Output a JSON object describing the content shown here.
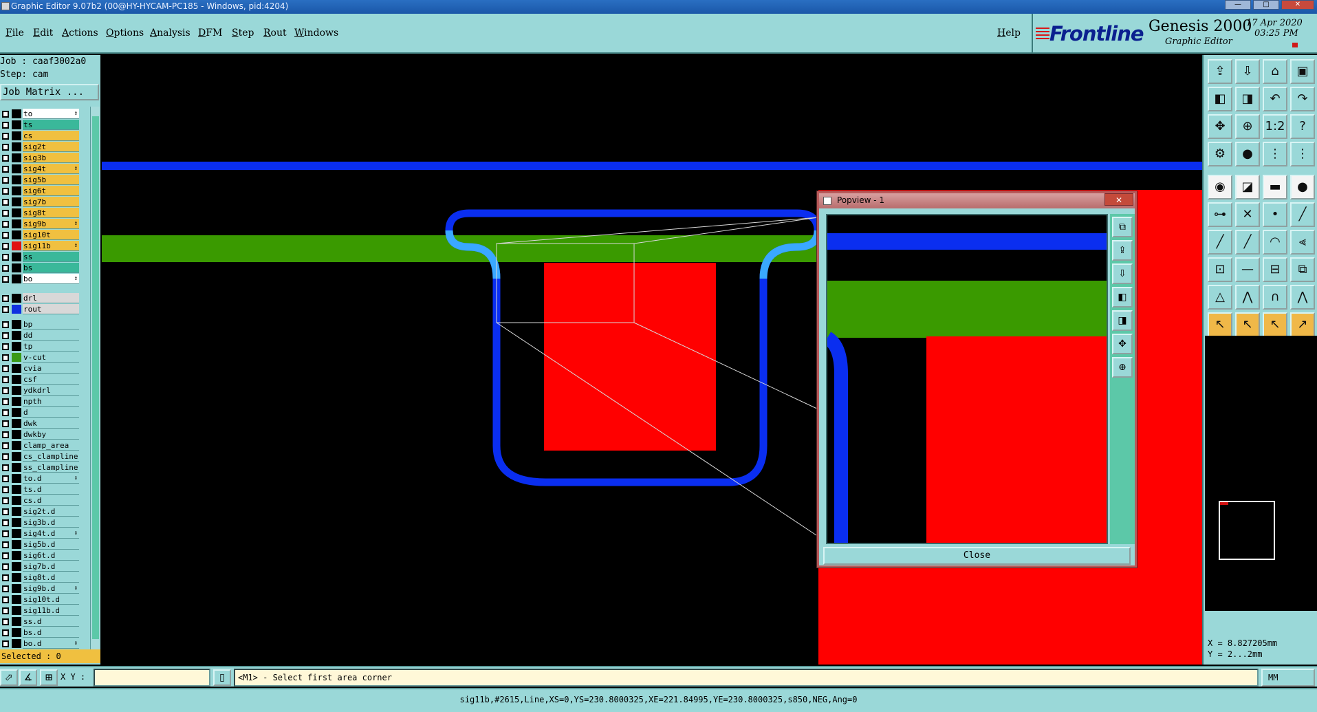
{
  "titlebar": {
    "title": "Graphic Editor 9.07b2 (00@HY-HYCAM-PC185 - Windows, pid:4204)"
  },
  "menu": {
    "items": [
      "File",
      "Edit",
      "Actions",
      "Options",
      "Analysis",
      "DFM",
      "Step",
      "Rout",
      "Windows"
    ],
    "help": "Help"
  },
  "brand": {
    "logo": "Frontline",
    "product": "Genesis 2000",
    "subtitle": "Graphic Editor",
    "date": "17 Apr 2020",
    "time": "03:25 PM"
  },
  "job": {
    "job_line": "Job : caaf3002a0",
    "step_line": "Step: cam",
    "matrix_button": "Job Matrix ..."
  },
  "layers": [
    {
      "name": "to",
      "bg": "#ffffff",
      "color": "#000000",
      "bar": true
    },
    {
      "name": "ts",
      "bg": "#3ab89a",
      "color": "#000000",
      "bar": false
    },
    {
      "name": "cs",
      "bg": "#f0c040",
      "color": "#000000",
      "bar": false
    },
    {
      "name": "sig2t",
      "bg": "#f0c040",
      "color": "#000000",
      "bar": false
    },
    {
      "name": "sig3b",
      "bg": "#f0c040",
      "color": "#000000",
      "bar": false
    },
    {
      "name": "sig4t",
      "bg": "#f0c040",
      "color": "#000000",
      "bar": true
    },
    {
      "name": "sig5b",
      "bg": "#f0c040",
      "color": "#000000",
      "bar": false
    },
    {
      "name": "sig6t",
      "bg": "#f0c040",
      "color": "#000000",
      "bar": false
    },
    {
      "name": "sig7b",
      "bg": "#f0c040",
      "color": "#000000",
      "bar": false
    },
    {
      "name": "sig8t",
      "bg": "#f0c040",
      "color": "#000000",
      "bar": false
    },
    {
      "name": "sig9b",
      "bg": "#f0c040",
      "color": "#000000",
      "bar": true
    },
    {
      "name": "sig10t",
      "bg": "#f0c040",
      "color": "#000000",
      "bar": false
    },
    {
      "name": "sig11b",
      "bg": "#f0c040",
      "color": "#e01010",
      "bar": true
    },
    {
      "name": "ss",
      "bg": "#3ab89a",
      "color": "#000000",
      "bar": false
    },
    {
      "name": "bs",
      "bg": "#3ab89a",
      "color": "#000000",
      "bar": false
    },
    {
      "name": "bo",
      "bg": "#ffffff",
      "color": "#000000",
      "bar": true
    },
    {
      "name": "drl",
      "bg": "#d8d8d8",
      "color": "#000000",
      "bar": false
    },
    {
      "name": "rout",
      "bg": "#d8d8d8",
      "color": "#1030e0",
      "bar": false
    },
    {
      "name": "bp",
      "bg": "#9ad8d8",
      "color": "#000000",
      "bar": false
    },
    {
      "name": "dd",
      "bg": "#9ad8d8",
      "color": "#000000",
      "bar": false
    },
    {
      "name": "tp",
      "bg": "#9ad8d8",
      "color": "#000000",
      "bar": false
    },
    {
      "name": "v-cut",
      "bg": "#9ad8d8",
      "color": "#3a9a18",
      "bar": false
    },
    {
      "name": "cvia",
      "bg": "#9ad8d8",
      "color": "#000000",
      "bar": false
    },
    {
      "name": "csf",
      "bg": "#9ad8d8",
      "color": "#000000",
      "bar": false
    },
    {
      "name": "ydkdrl",
      "bg": "#9ad8d8",
      "color": "#000000",
      "bar": false
    },
    {
      "name": "npth",
      "bg": "#9ad8d8",
      "color": "#000000",
      "bar": false
    },
    {
      "name": "d",
      "bg": "#9ad8d8",
      "color": "#000000",
      "bar": false
    },
    {
      "name": "dwk",
      "bg": "#9ad8d8",
      "color": "#000000",
      "bar": false
    },
    {
      "name": "dwkby",
      "bg": "#9ad8d8",
      "color": "#000000",
      "bar": false
    },
    {
      "name": "clamp_area",
      "bg": "#9ad8d8",
      "color": "#000000",
      "bar": false
    },
    {
      "name": "cs_clampline",
      "bg": "#9ad8d8",
      "color": "#000000",
      "bar": false
    },
    {
      "name": "ss_clampline",
      "bg": "#9ad8d8",
      "color": "#000000",
      "bar": false
    },
    {
      "name": "to.d",
      "bg": "#9ad8d8",
      "color": "#000000",
      "bar": true
    },
    {
      "name": "ts.d",
      "bg": "#9ad8d8",
      "color": "#000000",
      "bar": false
    },
    {
      "name": "cs.d",
      "bg": "#9ad8d8",
      "color": "#000000",
      "bar": false
    },
    {
      "name": "sig2t.d",
      "bg": "#9ad8d8",
      "color": "#000000",
      "bar": false
    },
    {
      "name": "sig3b.d",
      "bg": "#9ad8d8",
      "color": "#000000",
      "bar": false
    },
    {
      "name": "sig4t.d",
      "bg": "#9ad8d8",
      "color": "#000000",
      "bar": true
    },
    {
      "name": "sig5b.d",
      "bg": "#9ad8d8",
      "color": "#000000",
      "bar": false
    },
    {
      "name": "sig6t.d",
      "bg": "#9ad8d8",
      "color": "#000000",
      "bar": false
    },
    {
      "name": "sig7b.d",
      "bg": "#9ad8d8",
      "color": "#000000",
      "bar": false
    },
    {
      "name": "sig8t.d",
      "bg": "#9ad8d8",
      "color": "#000000",
      "bar": false
    },
    {
      "name": "sig9b.d",
      "bg": "#9ad8d8",
      "color": "#000000",
      "bar": true
    },
    {
      "name": "sig10t.d",
      "bg": "#9ad8d8",
      "color": "#000000",
      "bar": false
    },
    {
      "name": "sig11b.d",
      "bg": "#9ad8d8",
      "color": "#000000",
      "bar": false
    },
    {
      "name": "ss.d",
      "bg": "#9ad8d8",
      "color": "#000000",
      "bar": false
    },
    {
      "name": "bs.d",
      "bg": "#9ad8d8",
      "color": "#000000",
      "bar": false
    },
    {
      "name": "bo.d",
      "bg": "#9ad8d8",
      "color": "#000000",
      "bar": true
    }
  ],
  "selected": "Selected : 0",
  "coords": {
    "x": "X = 8.827205mm",
    "y": "Y = 2...2mm"
  },
  "cmd": {
    "xy_label": "X Y :",
    "xy_value": "",
    "prompt": "<M1> - Select first area corner",
    "units": "MM"
  },
  "status": "sig11b,#2615,Line,XS=0,YS=230.8000325,XE=221.84995,YE=230.8000325,s850,NEG,Ang=0",
  "popview": {
    "title": "Popview - 1",
    "close_label": "Close",
    "title_close": "✕"
  },
  "colors": {
    "bg": "#9ad8d8",
    "canvas": "#000000",
    "rout": "#0a2ef0",
    "rout_light": "#3aa8ff",
    "vcut": "#3a9a00",
    "sig": "#ff0000"
  },
  "toolbox_icons": [
    "home-icon",
    "store-icon",
    "house-icon",
    "window-icon",
    "left-icon",
    "right-icon",
    "undo-icon",
    "redo-icon",
    "fit-icon",
    "center-icon",
    "scale-icon",
    "help-icon",
    "measure-icon",
    "snap-icon",
    "grid-icon",
    "layers-icon",
    "pad-icon",
    "vector-icon",
    "ruler-icon",
    "circle-icon",
    "connect-icon",
    "cross-icon",
    "point-icon",
    "line-icon",
    "slash-icon",
    "diag-icon",
    "arc-icon",
    "text-icon",
    "node-icon",
    "dash-icon",
    "frame-icon",
    "group-icon",
    "triangle-icon",
    "mountain-icon",
    "arch-icon",
    "peak-icon",
    "select-icon",
    "select-box-icon",
    "select-arc-icon",
    "select-path-icon"
  ],
  "toolbox_glyphs": [
    "⇪",
    "⇩",
    "⌂",
    "▣",
    "◧",
    "◨",
    "↶",
    "↷",
    "✥",
    "⊕",
    "1:2",
    "?",
    "⚙",
    "●",
    "⋮",
    "⋮",
    "◉",
    "◪",
    "▬",
    "●",
    "⊶",
    "✕",
    "•",
    "╱",
    "╱",
    "╱",
    "◠",
    "⫷",
    "⊡",
    "—",
    "⊟",
    "⧉",
    "△",
    "⋀",
    "∩",
    "⋀",
    "↖",
    "↖",
    "↖",
    "↗"
  ],
  "popview_tools": [
    "⧉",
    "⇪",
    "⇩",
    "◧",
    "◨",
    "✥",
    "⊕"
  ]
}
